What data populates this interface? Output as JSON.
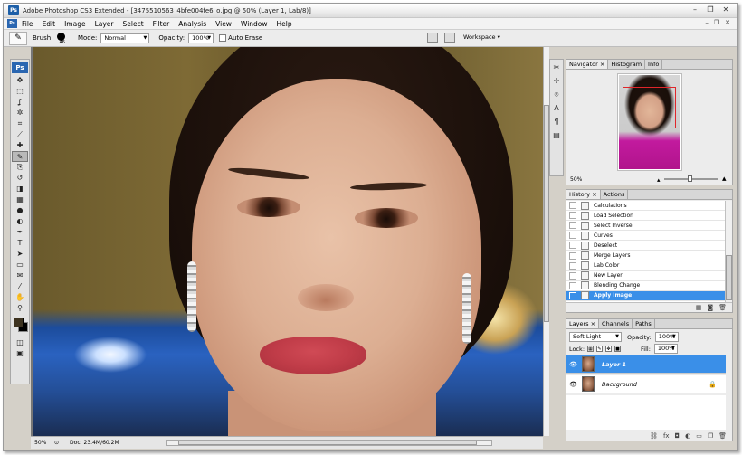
{
  "window": {
    "title": "Adobe Photoshop CS3 Extended - [3475510563_4bfe004fe6_o.jpg @ 50% (Layer 1, Lab/8)]",
    "app_icon": "Ps"
  },
  "menu": [
    "File",
    "Edit",
    "Image",
    "Layer",
    "Select",
    "Filter",
    "Analysis",
    "View",
    "Window",
    "Help"
  ],
  "options": {
    "brush_label": "Brush:",
    "brush_size": "46",
    "mode_label": "Mode:",
    "mode_value": "Normal",
    "opacity_label": "Opacity:",
    "opacity_value": "100%",
    "auto_erase_label": "Auto Erase",
    "workspace_label": "Workspace ▾"
  },
  "tools": {
    "logo": "Ps",
    "items": [
      "move-icon",
      "marquee-icon",
      "lasso-icon",
      "magic-wand-icon",
      "crop-icon",
      "slice-icon",
      "healing-brush-icon",
      "pencil-icon",
      "clone-stamp-icon",
      "history-brush-icon",
      "eraser-icon",
      "gradient-icon",
      "blur-icon",
      "dodge-icon",
      "pen-icon",
      "type-icon",
      "path-selection-icon",
      "rectangle-icon",
      "notes-icon",
      "eyedropper-icon",
      "hand-icon",
      "zoom-icon"
    ],
    "glyphs": [
      "✥",
      "⬚",
      "ʆ",
      "✲",
      "⌗",
      "⟋",
      "✚",
      "✎",
      "⎘",
      "↺",
      "◨",
      "▦",
      "●",
      "◐",
      "✒",
      "T",
      "➤",
      "▭",
      "✉",
      "⁄",
      "✋",
      "⚲"
    ]
  },
  "status": {
    "zoom": "50%",
    "doc": "Doc: 23.4M/60.2M"
  },
  "navigator": {
    "tabs": [
      "Navigator ×",
      "Histogram",
      "Info"
    ],
    "zoom": "50%"
  },
  "history": {
    "tabs": [
      "History ×",
      "Actions"
    ],
    "items": [
      "Calculations",
      "Load Selection",
      "Select Inverse",
      "Curves",
      "Deselect",
      "Merge Layers",
      "Lab Color",
      "New Layer",
      "Blending Change",
      "Apply Image"
    ],
    "selected_index": 9
  },
  "layers": {
    "tabs": [
      "Layers ×",
      "Channels",
      "Paths"
    ],
    "blend_mode": "Soft Light",
    "opacity_label": "Opacity:",
    "opacity_value": "100%",
    "lock_label": "Lock:",
    "fill_label": "Fill:",
    "fill_value": "100%",
    "items": [
      {
        "name": "Layer 1",
        "selected": true
      },
      {
        "name": "Background",
        "selected": false,
        "locked": true
      }
    ]
  },
  "colors": {
    "selection": "#3a8fe8",
    "foreground": "#3d3320",
    "background": "#000000"
  }
}
